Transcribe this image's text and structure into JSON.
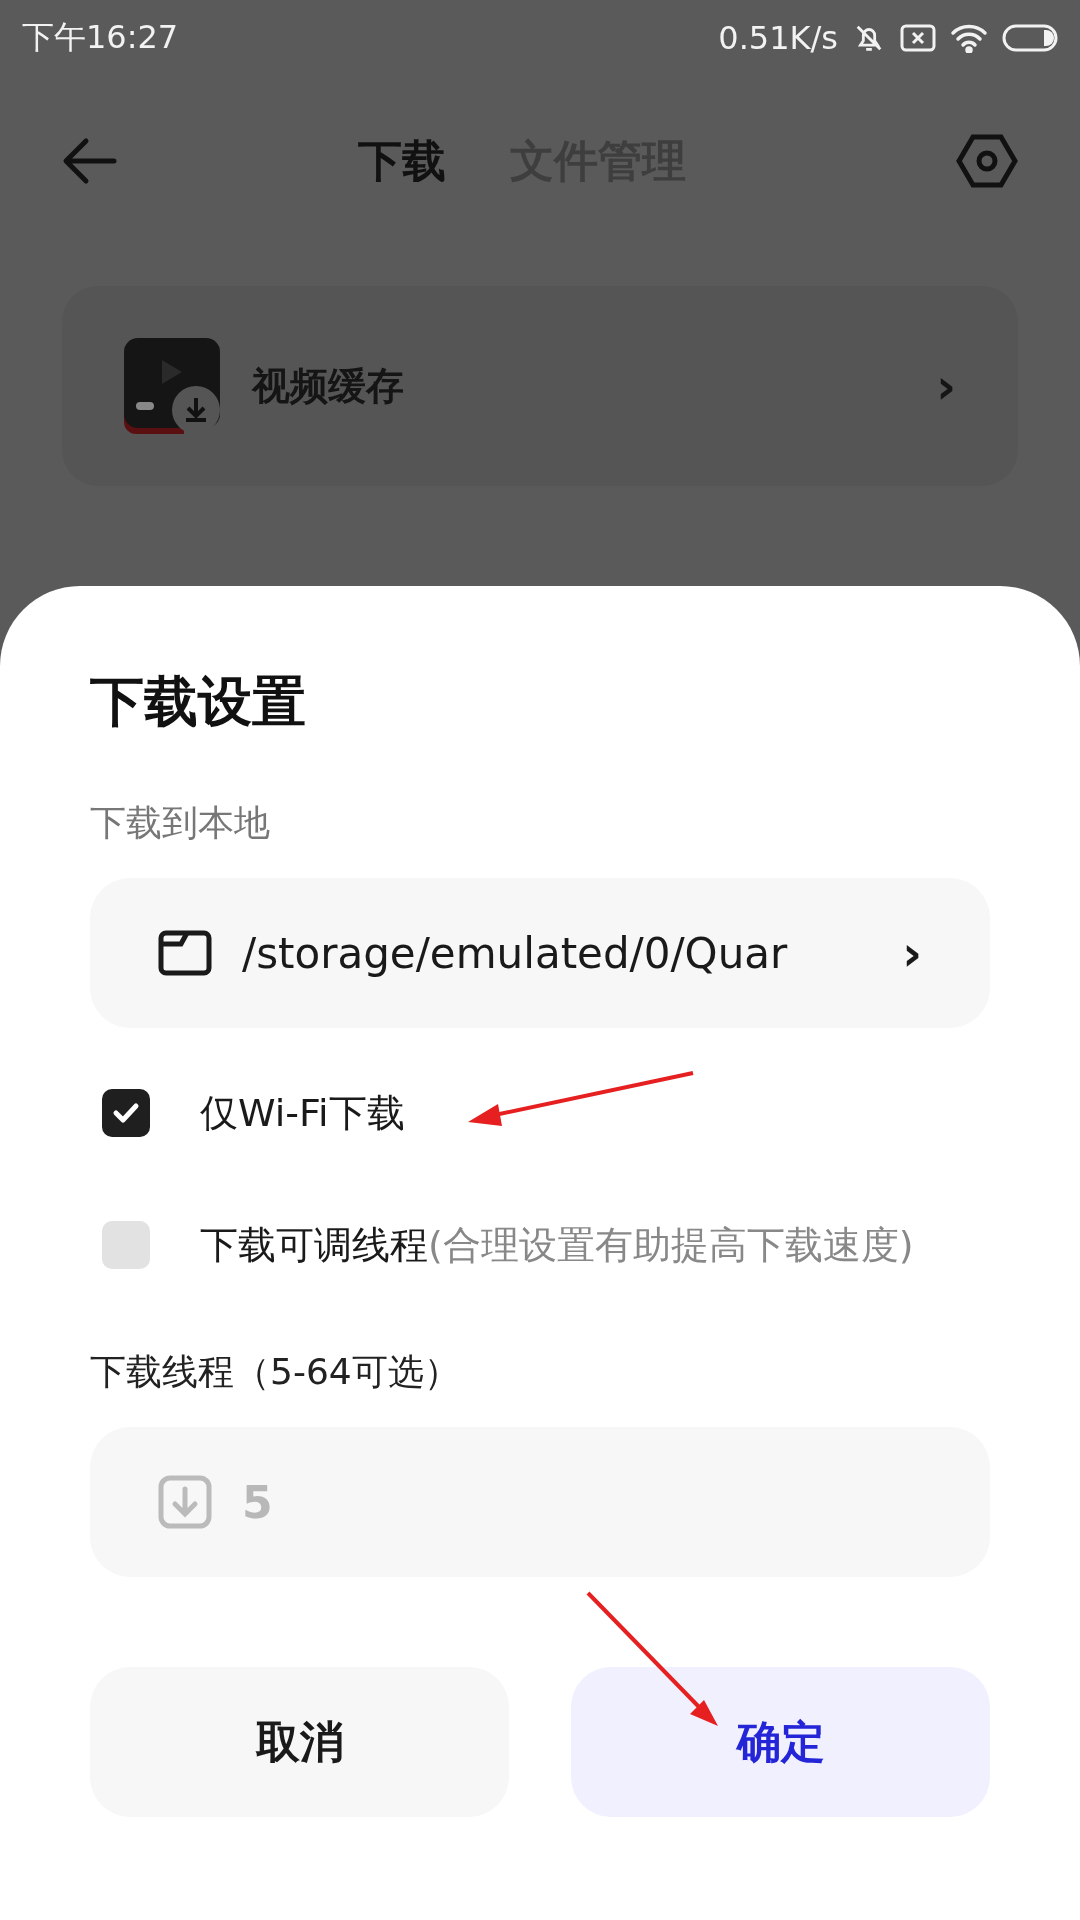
{
  "status_bar": {
    "time": "下午16:27",
    "speed": "0.51K/s"
  },
  "header": {
    "tabs": [
      {
        "label": "下载",
        "selected": true
      },
      {
        "label": "文件管理",
        "selected": false
      }
    ]
  },
  "list": [
    {
      "label": "视频缓存",
      "chevron": "›"
    }
  ],
  "dialog": {
    "title": "下载设置",
    "location_label": "下载到本地",
    "path": "/storage/emulated/0/Quar",
    "path_chevron": "›",
    "options": [
      {
        "label": "仅Wi-Fi下载",
        "checked": true
      },
      {
        "label": "下载可调线程",
        "hint": "(合理设置有助提高下载速度)",
        "checked": false
      }
    ],
    "threads_label": "下载线程（5-64可选）",
    "threads": {
      "value": "5",
      "disabled": true
    },
    "buttons": [
      {
        "label": "取消",
        "kind": "cancel"
      },
      {
        "label": "确定",
        "kind": "confirm"
      }
    ]
  }
}
